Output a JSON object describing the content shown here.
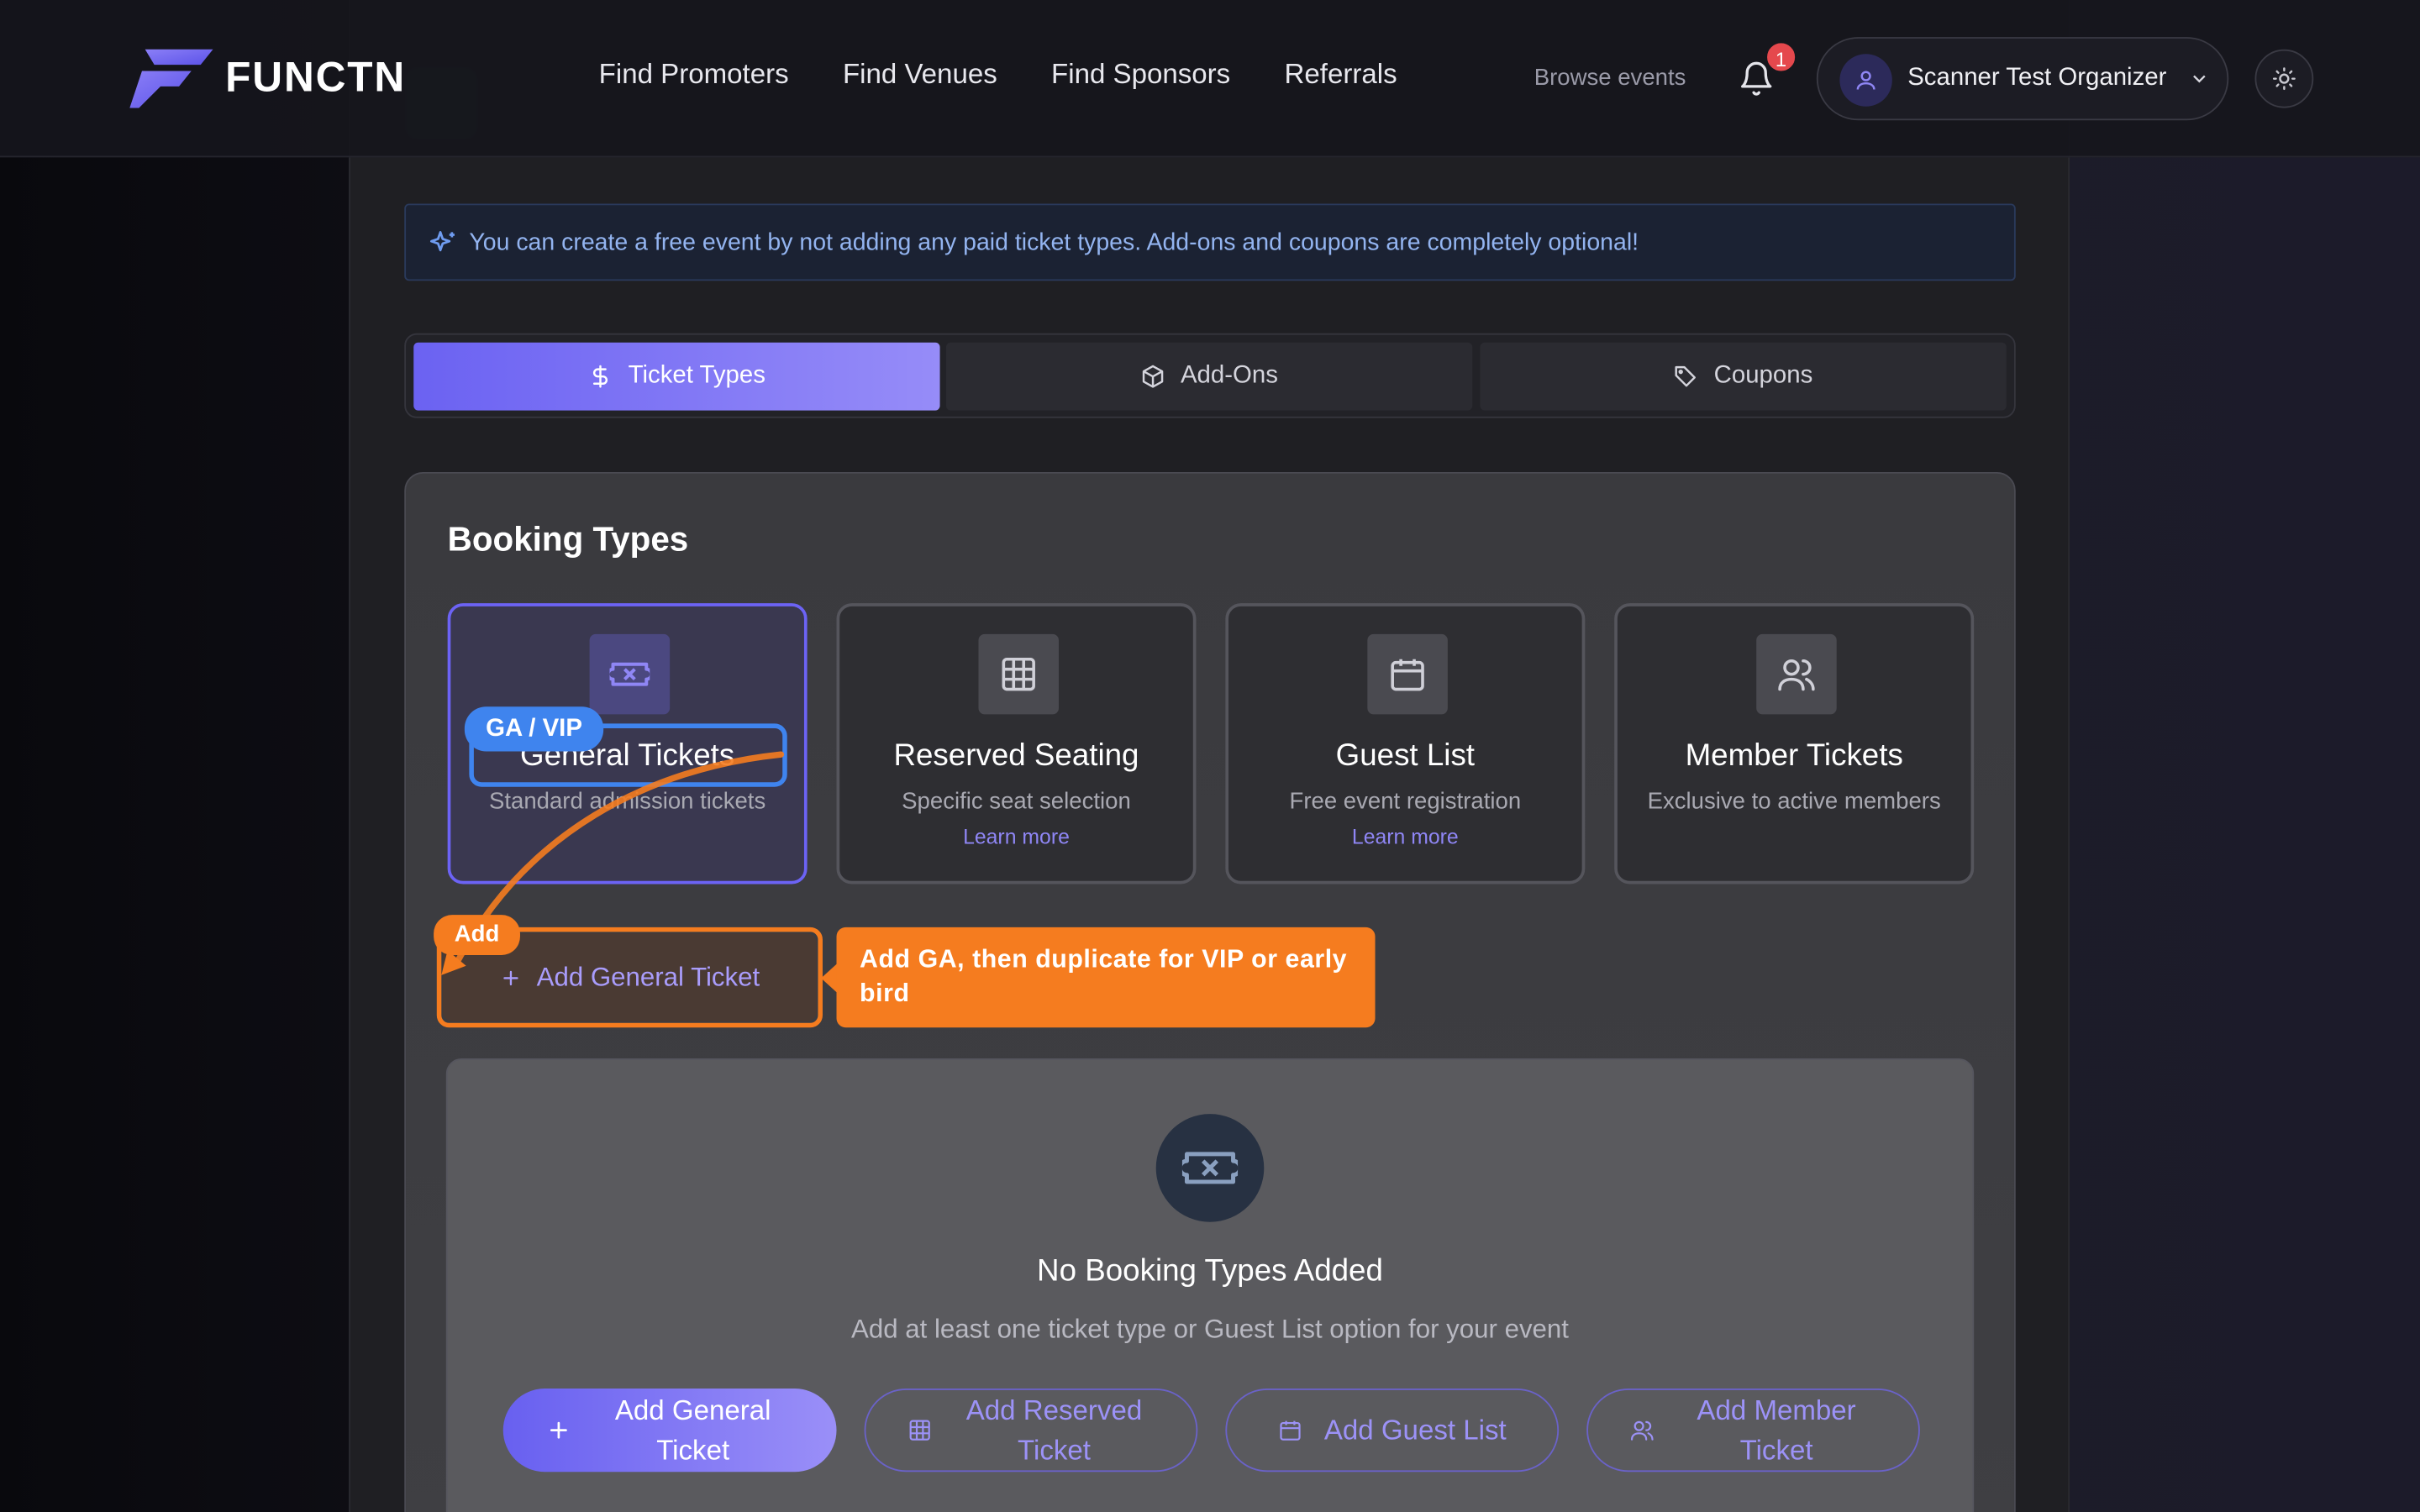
{
  "brand": {
    "name": "FUNCTN"
  },
  "nav": {
    "links": [
      "Find Promoters",
      "Find Venues",
      "Find Sponsors",
      "Referrals"
    ],
    "browse_label": "Browse events",
    "notification_count": "1",
    "user_name": "Scanner Test Organizer"
  },
  "info_banner": {
    "text": "You can create a free event by not adding any paid ticket types. Add-ons and coupons are completely optional!"
  },
  "tabs": [
    {
      "label": "Ticket Types",
      "icon": "dollar-icon",
      "active": true
    },
    {
      "label": "Add-Ons",
      "icon": "package-icon",
      "active": false
    },
    {
      "label": "Coupons",
      "icon": "tag-icon",
      "active": false
    }
  ],
  "booking": {
    "title": "Booking Types",
    "types": [
      {
        "title": "General Tickets",
        "desc": "Standard admission tickets",
        "link": "",
        "icon": "ticket-icon",
        "selected": true
      },
      {
        "title": "Reserved Seating",
        "desc": "Specific seat selection",
        "link": "Learn more",
        "icon": "grid-icon",
        "selected": false
      },
      {
        "title": "Guest List",
        "desc": "Free event registration",
        "link": "Learn more",
        "icon": "calendar-icon",
        "selected": false
      },
      {
        "title": "Member Tickets",
        "desc": "Exclusive to active members",
        "link": "",
        "icon": "users-icon",
        "selected": false
      }
    ],
    "add_general_label": "Add General Ticket"
  },
  "annotations": {
    "ga_tag": "GA / VIP",
    "add_tag": "Add",
    "callout": "Add GA, then duplicate for VIP or early bird",
    "accent_orange": "#f57c1f",
    "accent_blue": "#3f84ee"
  },
  "empty_state": {
    "title": "No Booking Types Added",
    "subtitle": "Add at least one ticket type or Guest List option for your event",
    "buttons": [
      {
        "label": "Add General Ticket",
        "icon": "plus-icon",
        "primary": true
      },
      {
        "label": "Add Reserved Ticket",
        "icon": "grid-icon",
        "primary": false
      },
      {
        "label": "Add Guest List",
        "icon": "calendar-icon",
        "primary": false
      },
      {
        "label": "Add Member Ticket",
        "icon": "users-icon",
        "primary": false
      }
    ]
  },
  "colors": {
    "primary": "#6b62f2",
    "primary_light": "#968cf8",
    "link": "#8f86f5"
  }
}
